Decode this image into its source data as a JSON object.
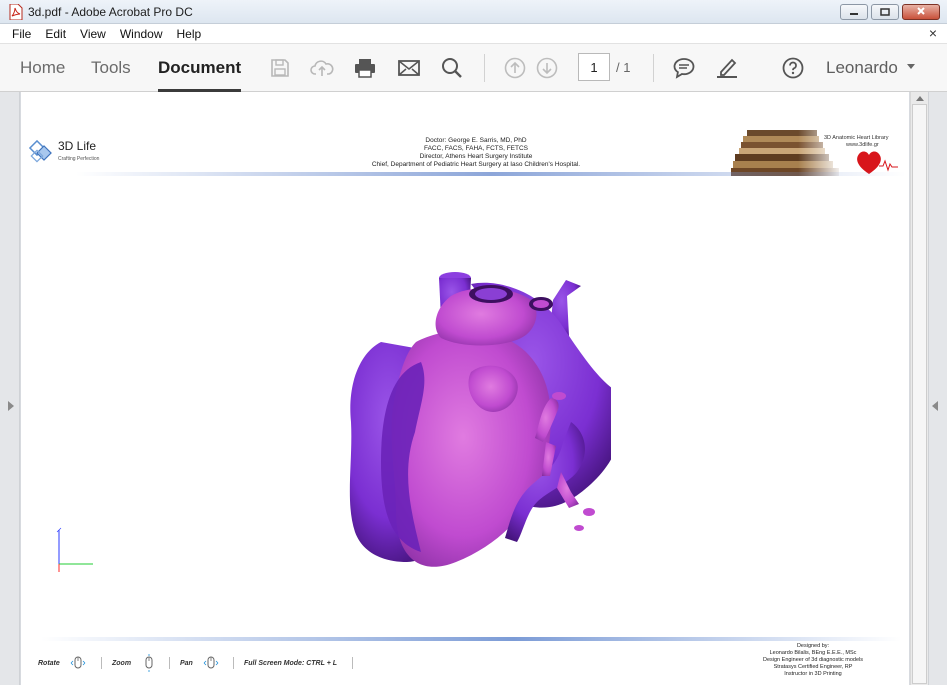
{
  "window": {
    "title": "3d.pdf - Adobe Acrobat Pro DC",
    "minimize_icon": "minimize-icon",
    "maximize_icon": "maximize-icon",
    "close_icon": "close-icon"
  },
  "menu": {
    "items": [
      "File",
      "Edit",
      "View",
      "Window",
      "Help"
    ],
    "close_glyph": "×"
  },
  "toolbar": {
    "tabs": [
      {
        "label": "Home",
        "active": false
      },
      {
        "label": "Tools",
        "active": false
      },
      {
        "label": "Document",
        "active": true
      }
    ],
    "icons": [
      "save-icon",
      "upload-icon",
      "print-icon",
      "email-icon",
      "search-icon",
      "page-up-icon",
      "page-down-icon",
      "comment-icon",
      "highlight-icon",
      "help-icon"
    ],
    "page_current": "1",
    "page_total": "/ 1",
    "user_name": "Leonardo"
  },
  "page": {
    "logo_title": "3D Life",
    "logo_subtitle": "Crafting Perfection",
    "header_lines": [
      "Doctor: George E. Sarris, MD, PhD",
      "FACC, FACS, FAHA, FCTS, FETCS",
      "Director, Athens Heart Surgery Institute",
      "Chief, Department of Pediatric Heart Surgery at Iaso Children's Hospital."
    ],
    "library_title": "3D Anatomic Heart Library",
    "library_url": "www.3dlife.gr",
    "controls": [
      {
        "label": "Rotate",
        "icon": "mouse-rotate-icon"
      },
      {
        "label": "Zoom",
        "icon": "mouse-zoom-icon"
      },
      {
        "label": "Pan",
        "icon": "mouse-pan-icon"
      }
    ],
    "fullscreen_label": "Full Screen Mode:  CTRL + L",
    "designed_lines": [
      "Designed by:",
      "Leonardo Bilalis, BEng E.E.E., MSc",
      "Design Engineer of 3d diagnostic models",
      "Stratasys Certified Engineer, RP",
      "Instructor in 3D Printing"
    ]
  },
  "colors": {
    "heart_purple": "#7b2fd2",
    "heart_pink": "#c04bd0",
    "accent_line": "#7896d2"
  }
}
